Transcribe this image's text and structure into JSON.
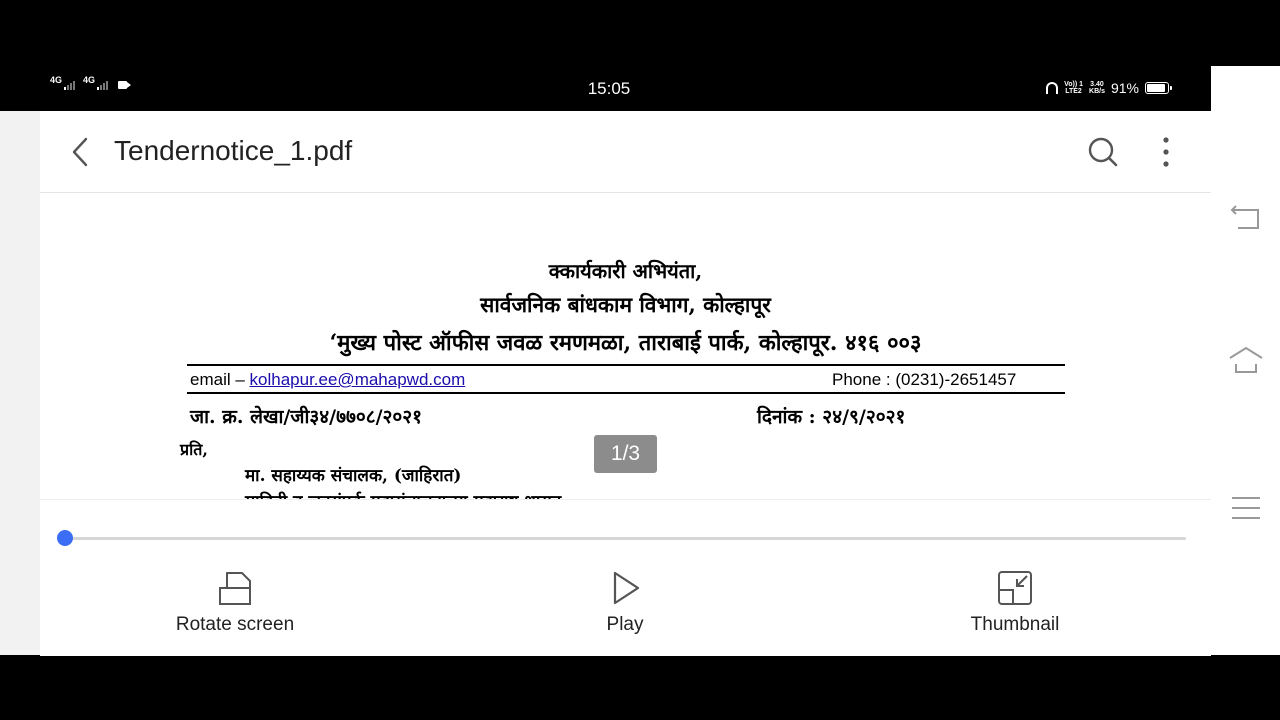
{
  "status_bar": {
    "network1": "4G",
    "network2": "4G",
    "time": "15:05",
    "volte_top": "Vo)) 1",
    "volte_bottom": "LTE2",
    "speed_top": "3.40",
    "speed_bottom": "KB/s",
    "battery_percent": "91%",
    "battery_level": 0.91
  },
  "app_bar": {
    "title": "Tendernotice_1.pdf",
    "back_icon": "chevron-left-icon",
    "search_icon": "search-icon",
    "more_icon": "more-vertical-icon"
  },
  "document": {
    "heading_line1": "क्‍कार्यकारी अभियंता,",
    "heading_line2": "सार्वजनिक बांधकाम विभाग, कोल्हापूर",
    "heading_line3": "‘मुख्य पोस्ट ऑफीस जवळ रमणमळा, ताराबाई पार्क, कोल्हापूर. ४१६ ००३",
    "email_label": "email – ",
    "email_value": "kolhapur.ee@mahapwd.com",
    "phone": "Phone : (0231)-2651457",
    "reference": "जा. क्र. लेखा/जी३४/७७०८/२०२१",
    "date": "दिनांक : २४/९/२०२१",
    "to": "प्रति,",
    "addressee": "मा. सहाय्यक संचालक, (जाहिरात)",
    "addressee_line2": "माहिती व जनसंपर्क महासंचालनालय महाराष्ट्र शासन"
  },
  "page_indicator": "1/3",
  "progress": 0.0,
  "controls": {
    "rotate_label": "Rotate screen",
    "play_label": "Play",
    "thumbnail_label": "Thumbnail"
  },
  "nav": {
    "back_icon": "nav-back-icon",
    "home_icon": "nav-home-icon",
    "menu_icon": "nav-menu-icon"
  },
  "accent": "#3b6ef5"
}
